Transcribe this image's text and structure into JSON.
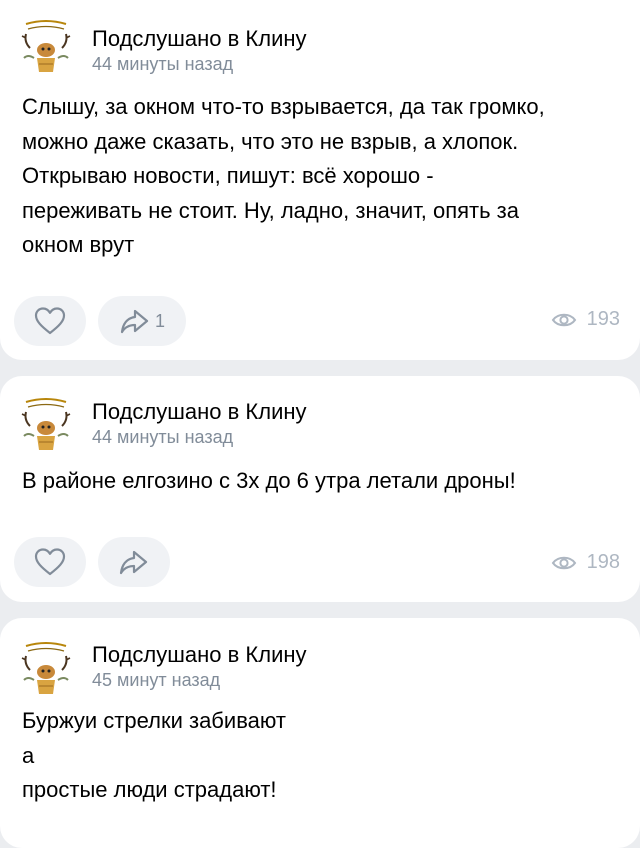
{
  "colors": {
    "background": "#ebedf0",
    "card": "#ffffff",
    "button": "#f0f2f5",
    "secondary_text": "#818c99",
    "icon": "#818c99",
    "views_text": "#aeb7c2"
  },
  "icons": {
    "like": "heart-outline-icon",
    "share": "share-arrow-icon",
    "views": "eye-icon"
  },
  "posts": [
    {
      "author": "Подслушано в Клину",
      "time": "44 минуты назад",
      "text": "Слышу, за окном что-то взрывается, да так громко,\nможно даже сказать, что это не взрыв, а хлопок.\nОткрываю новости, пишут: всё хорошо -\nпереживать не стоит. Ну, ладно, значит, опять за\nокном врут",
      "shares": "1",
      "views": "193"
    },
    {
      "author": "Подслушано в Клину",
      "time": "44 минуты назад",
      "text": "В районе елгозино с 3х до 6 утра летали дроны!",
      "views": "198"
    },
    {
      "author": "Подслушано в Клину",
      "time": "45 минут назад",
      "text": "Буржуи стрелки забивают\nа\nпростые люди страдают!"
    }
  ]
}
